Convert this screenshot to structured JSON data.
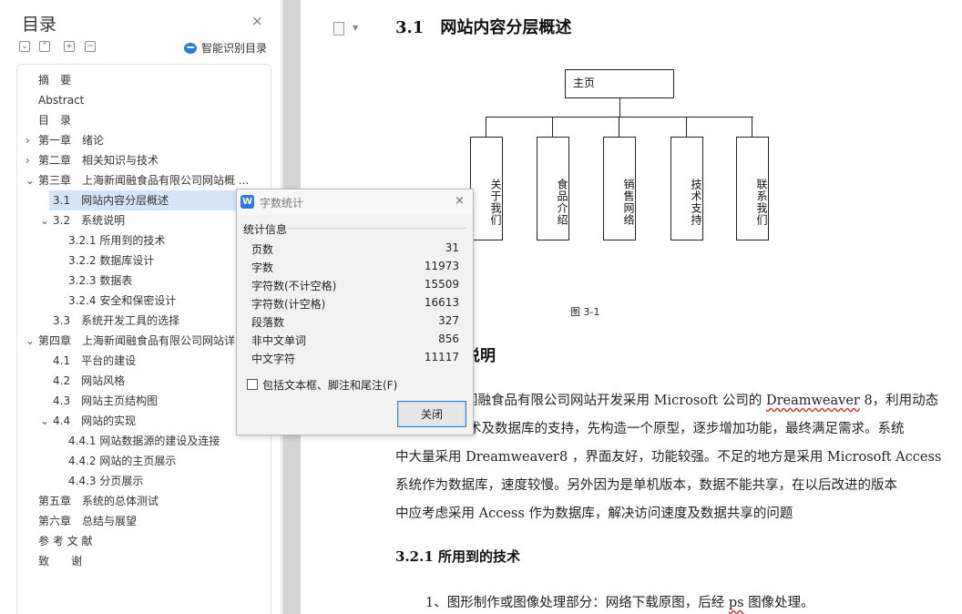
{
  "toc": {
    "title": "目录",
    "close_icon": "×",
    "smart_toc_label": "智能识别目录",
    "items": [
      {
        "label": "摘　要",
        "level": 0,
        "arrow": ""
      },
      {
        "label": "Abstract",
        "level": 0,
        "arrow": ""
      },
      {
        "label": "目　录",
        "level": 0,
        "arrow": ""
      },
      {
        "label": "第一章　绪论",
        "level": 0,
        "arrow": "›"
      },
      {
        "label": "第二章　相关知识与技术",
        "level": 0,
        "arrow": "›"
      },
      {
        "label": "第三章　上海新闻融食品有限公司网站概 ...",
        "level": 0,
        "arrow": "⌄"
      },
      {
        "label": "3.1　网站内容分层概述",
        "level": 1,
        "arrow": "",
        "selected": true
      },
      {
        "label": "3.2　系统说明",
        "level": 1,
        "arrow": "⌄"
      },
      {
        "label": "3.2.1 所用到的技术",
        "level": 2,
        "arrow": ""
      },
      {
        "label": "3.2.2 数据库设计",
        "level": 2,
        "arrow": ""
      },
      {
        "label": "3.2.3 数据表",
        "level": 2,
        "arrow": ""
      },
      {
        "label": "3.2.4 安全和保密设计",
        "level": 2,
        "arrow": ""
      },
      {
        "label": "3.3　系统开发工具的选择",
        "level": 1,
        "arrow": ""
      },
      {
        "label": "第四章　上海新闻融食品有限公司网站详",
        "level": 0,
        "arrow": "⌄"
      },
      {
        "label": "4.1　平台的建设",
        "level": 1,
        "arrow": ""
      },
      {
        "label": "4.2　网站风格",
        "level": 1,
        "arrow": ""
      },
      {
        "label": "4.3　网站主页结构图",
        "level": 1,
        "arrow": ""
      },
      {
        "label": "4.4　网站的实现",
        "level": 1,
        "arrow": "⌄"
      },
      {
        "label": "4.4.1 网站数据源的建设及连接",
        "level": 2,
        "arrow": ""
      },
      {
        "label": "4.4.2 网站的主页展示",
        "level": 2,
        "arrow": ""
      },
      {
        "label": "4.4.3 分页展示",
        "level": 2,
        "arrow": ""
      },
      {
        "label": "第五章　系统的总体测试",
        "level": 0,
        "arrow": ""
      },
      {
        "label": "第六章　总结与展望",
        "level": 0,
        "arrow": ""
      },
      {
        "label": "参 考 文 献",
        "level": 0,
        "arrow": ""
      },
      {
        "label": "致　　谢",
        "level": 0,
        "arrow": ""
      }
    ]
  },
  "document": {
    "section_title": "3.1　网站内容分层概述",
    "diagram": {
      "root": "主页",
      "children": [
        "关于我们",
        "食品介绍",
        "销售网络",
        "技术支持",
        "联系我们"
      ]
    },
    "figure_caption": "图 3-1",
    "sub_heading_visible": "说明",
    "paragraph_lines": [
      {
        "text": "闻融食品有限公司网站开发采用 Microsoft 公司的 ",
        "wavy": "Dreamweaver",
        "after": " 8，利用动态"
      },
      {
        "text": "术及数据库的支持，先构造一个原型，逐步增加功能，最终满足需求。系统"
      },
      {
        "text": "中大量采用 Dreamweaver8 ，界面友好，功能较强。不足的地方是采用 Microsoft Access"
      },
      {
        "text": "系统作为数据库，速度较慢。另外因为是单机版本，数据不能共享，在以后改进的版本"
      },
      {
        "text": "中应考虑采用 Access 作为数据库，解决访问速度及数据共享的问题"
      }
    ],
    "heading_321": "3.2.1 所用到的技术",
    "list_item_prefix": "1、图形制作或图像处理部分：网络下载原图，后经 ",
    "list_item_wavy": "ps",
    "list_item_suffix": " 图像处理。"
  },
  "dialog": {
    "title": "字数统计",
    "app_icon": "W",
    "close_icon": "×",
    "section_label": "统计信息",
    "stats": [
      {
        "label": "页数",
        "value": "31"
      },
      {
        "label": "字数",
        "value": "11973"
      },
      {
        "label": "字符数(不计空格)",
        "value": "15509"
      },
      {
        "label": "字符数(计空格)",
        "value": "16613"
      },
      {
        "label": "段落数",
        "value": "327"
      },
      {
        "label": "非中文单词",
        "value": "856"
      },
      {
        "label": "中文字符",
        "value": "11117"
      }
    ],
    "checkbox_label": "包括文本框、脚注和尾注(F)",
    "checkbox_checked": false,
    "close_button_label": "关闭"
  }
}
